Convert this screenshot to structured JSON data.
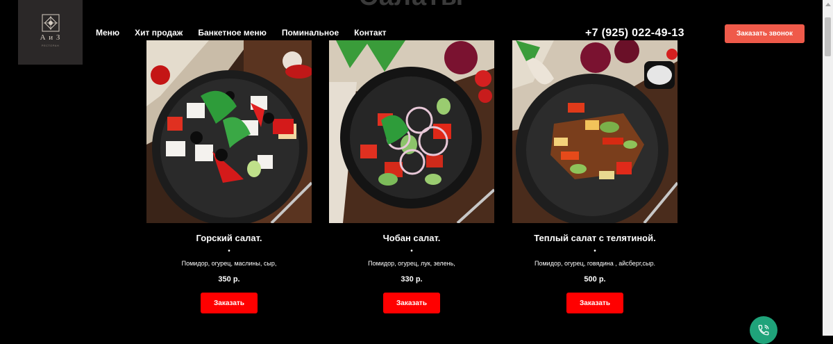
{
  "section": {
    "title": "Салаты"
  },
  "logo": {
    "text": "А и З",
    "subtitle": "РЕСТОРАН"
  },
  "nav": {
    "items": [
      "Меню",
      "Хит продаж",
      "Банкетное меню",
      "Поминальное",
      "Контакт"
    ]
  },
  "header": {
    "phone": "+7 (925) 022-49-13",
    "call_button": "Заказать звонок"
  },
  "products": [
    {
      "name": "Горский салат.",
      "dot": "•",
      "description": "Помидор, огурец, маслины, сыр,",
      "price": "350 р.",
      "button": "Заказать"
    },
    {
      "name": "Чобан салат.",
      "dot": "•",
      "description": "Помидор, огурец, лук, зелень,",
      "price": "330 р.",
      "button": "Заказать"
    },
    {
      "name": "Теплый салат с телятиной.",
      "dot": "•",
      "description": "Помидор, огурец, говядина , айсберг,сыр.",
      "price": "500 р.",
      "button": "Заказать"
    }
  ],
  "colors": {
    "accent": "#ef5a4a",
    "order": "#ff0000",
    "fab": "#1fa37a"
  },
  "icons": {
    "fab": "phone-call-icon"
  }
}
